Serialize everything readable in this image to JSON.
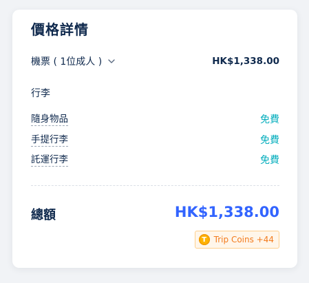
{
  "price_details": {
    "title": "價格詳情",
    "ticket": {
      "label": "機票 ( 1位成人 )",
      "price": "HK$1,338.00"
    },
    "baggage": {
      "title": "行李",
      "items": [
        {
          "name": "隨身物品",
          "value": "免費"
        },
        {
          "name": "手提行李",
          "value": "免費"
        },
        {
          "name": "託運行李",
          "value": "免費"
        }
      ]
    },
    "total": {
      "label": "總額",
      "price": "HK$1,338.00"
    },
    "trip_coins": {
      "icon_letter": "T",
      "icon": "trip-coin-icon",
      "text": "Trip Coins +44"
    }
  },
  "colors": {
    "primary_text": "#0f294d",
    "free": "#06aebd",
    "total_price": "#3264ff",
    "coins_text": "#f37b1d",
    "coins_bg": "#fff6ea"
  }
}
